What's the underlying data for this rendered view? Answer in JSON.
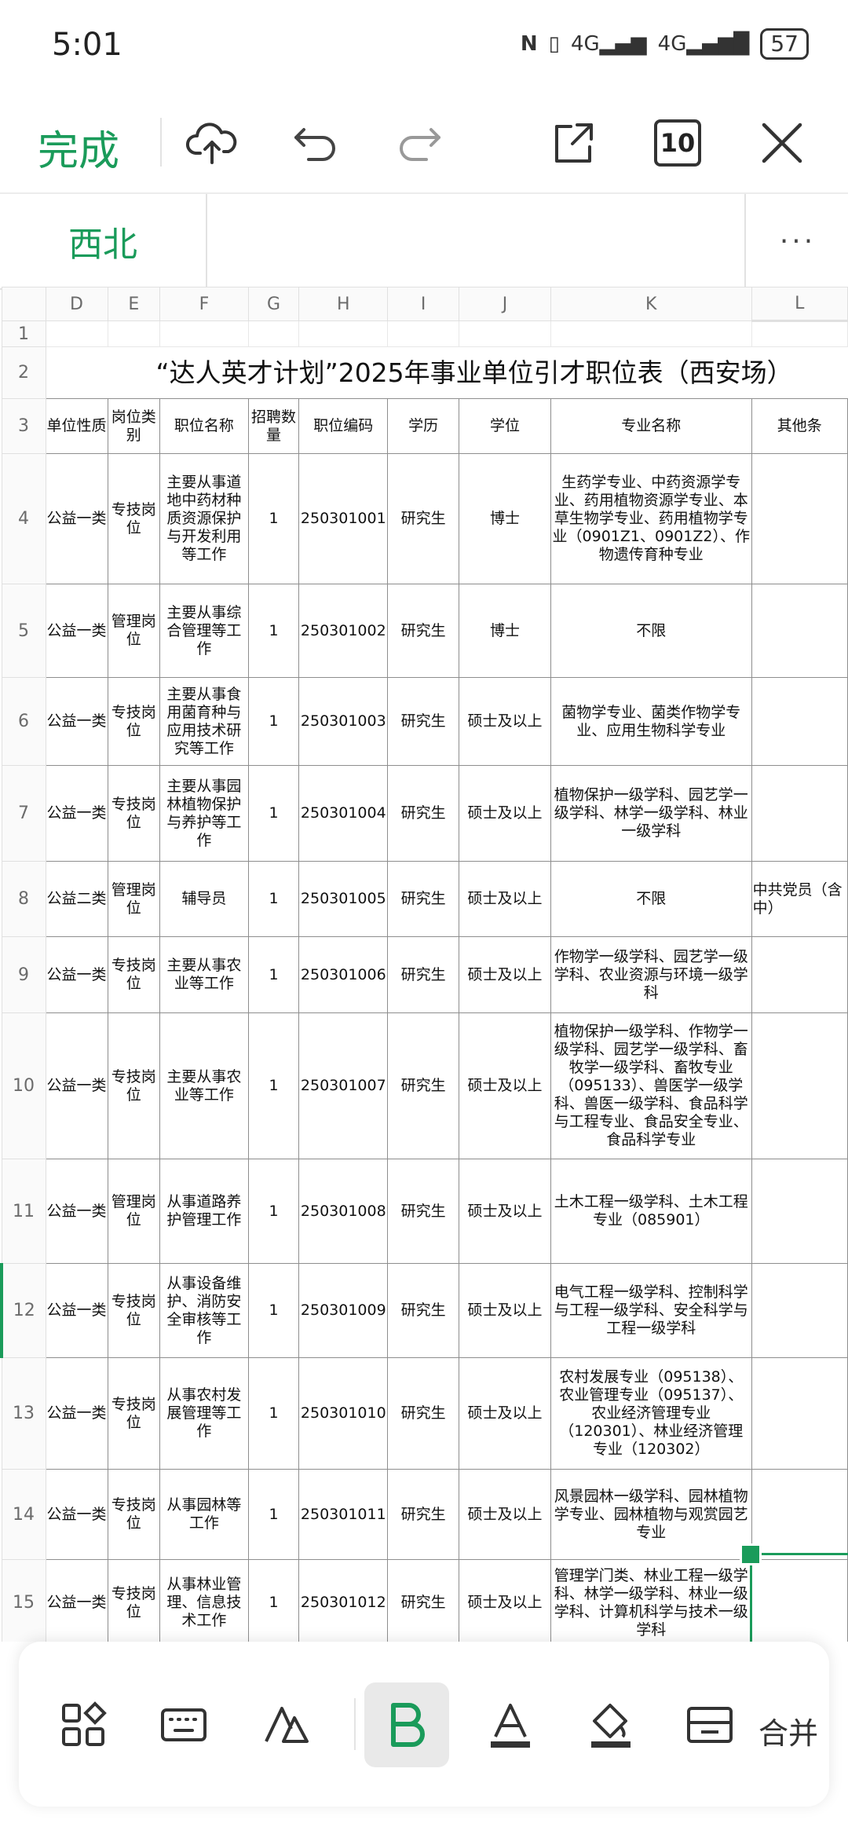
{
  "status_bar": {
    "time": "5:01",
    "signal1": "4G",
    "signal2": "4G",
    "battery": "57"
  },
  "toolbar": {
    "done_label": "完成",
    "page_count": "10"
  },
  "sheet_tab": {
    "name": "西北",
    "more": "···"
  },
  "columns": [
    "D",
    "E",
    "F",
    "G",
    "H",
    "I",
    "J",
    "K",
    "L"
  ],
  "title": "“达人英才计划”2025年事业单位引才职位表（西安场）",
  "header": {
    "row": "3",
    "cells": [
      "单位性质",
      "岗位类别",
      "职位名称",
      "招聘数量",
      "职位编码",
      "学历",
      "学位",
      "专业名称",
      "其他条"
    ]
  },
  "rows": [
    {
      "num": "4",
      "d": "公益一类",
      "e": "专技岗位",
      "f": "主要从事道地中药材种质资源保护与开发利用等工作",
      "g": "1",
      "h": "250301001",
      "i": "研究生",
      "j": "博士",
      "k": "生药学专业、中药资源学专业、药用植物资源学专业、本草生物学专业、药用植物学专业（0901Z1、0901Z2）、作物遗传育种专业",
      "l": ""
    },
    {
      "num": "5",
      "d": "公益一类",
      "e": "管理岗位",
      "f": "主要从事综合管理等工作",
      "g": "1",
      "h": "250301002",
      "i": "研究生",
      "j": "博士",
      "k": "不限",
      "l": ""
    },
    {
      "num": "6",
      "d": "公益一类",
      "e": "专技岗位",
      "f": "主要从事食用菌育种与应用技术研究等工作",
      "g": "1",
      "h": "250301003",
      "i": "研究生",
      "j": "硕士及以上",
      "k": "菌物学专业、菌类作物学专业、应用生物科学专业",
      "l": ""
    },
    {
      "num": "7",
      "d": "公益一类",
      "e": "专技岗位",
      "f": "主要从事园林植物保护与养护等工作",
      "g": "1",
      "h": "250301004",
      "i": "研究生",
      "j": "硕士及以上",
      "k": "植物保护一级学科、园艺学一级学科、林学一级学科、林业一级学科",
      "l": ""
    },
    {
      "num": "8",
      "d": "公益二类",
      "e": "管理岗位",
      "f": "辅导员",
      "g": "1",
      "h": "250301005",
      "i": "研究生",
      "j": "硕士及以上",
      "k": "不限",
      "l": "中共党员（含中）"
    },
    {
      "num": "9",
      "d": "公益一类",
      "e": "专技岗位",
      "f": "主要从事农业等工作",
      "g": "1",
      "h": "250301006",
      "i": "研究生",
      "j": "硕士及以上",
      "k": "作物学一级学科、园艺学一级学科、农业资源与环境一级学科",
      "l": ""
    },
    {
      "num": "10",
      "d": "公益一类",
      "e": "专技岗位",
      "f": "主要从事农业等工作",
      "g": "1",
      "h": "250301007",
      "i": "研究生",
      "j": "硕士及以上",
      "k": "植物保护一级学科、作物学一级学科、园艺学一级学科、畜牧学一级学科、畜牧专业（095133）、兽医学一级学科、兽医一级学科、食品科学与工程专业、食品安全专业、食品科学专业",
      "l": ""
    },
    {
      "num": "11",
      "d": "公益一类",
      "e": "管理岗位",
      "f": "从事道路养护管理工作",
      "g": "1",
      "h": "250301008",
      "i": "研究生",
      "j": "硕士及以上",
      "k": "土木工程一级学科、土木工程专业（085901）",
      "l": ""
    },
    {
      "num": "12",
      "d": "公益一类",
      "e": "专技岗位",
      "f": "从事设备维护、消防安全审核等工作",
      "g": "1",
      "h": "250301009",
      "i": "研究生",
      "j": "硕士及以上",
      "k": "电气工程一级学科、控制科学与工程一级学科、安全科学与工程一级学科",
      "l": ""
    },
    {
      "num": "13",
      "d": "公益一类",
      "e": "专技岗位",
      "f": "从事农村发展管理等工作",
      "g": "1",
      "h": "250301010",
      "i": "研究生",
      "j": "硕士及以上",
      "k": "农村发展专业（095138）、农业管理专业（095137）、农业经济管理专业（120301）、林业经济管理专业（120302）",
      "l": ""
    },
    {
      "num": "14",
      "d": "公益一类",
      "e": "专技岗位",
      "f": "从事园林等工作",
      "g": "1",
      "h": "250301011",
      "i": "研究生",
      "j": "硕士及以上",
      "k": "风景园林一级学科、园林植物学专业、园林植物与观赏园艺专业",
      "l": ""
    },
    {
      "num": "15",
      "d": "公益一类",
      "e": "专技岗位",
      "f": "从事林业管理、信息技术工作",
      "g": "1",
      "h": "250301012",
      "i": "研究生",
      "j": "硕士及以上",
      "k": "管理学门类、林业工程一级学科、林学一级学科、林业一级学科、计算机科学与技术一级学科",
      "l": ""
    }
  ],
  "bottom_bar": {
    "merge_label": "合并"
  },
  "colors": {
    "accent": "#1a9b5a"
  }
}
